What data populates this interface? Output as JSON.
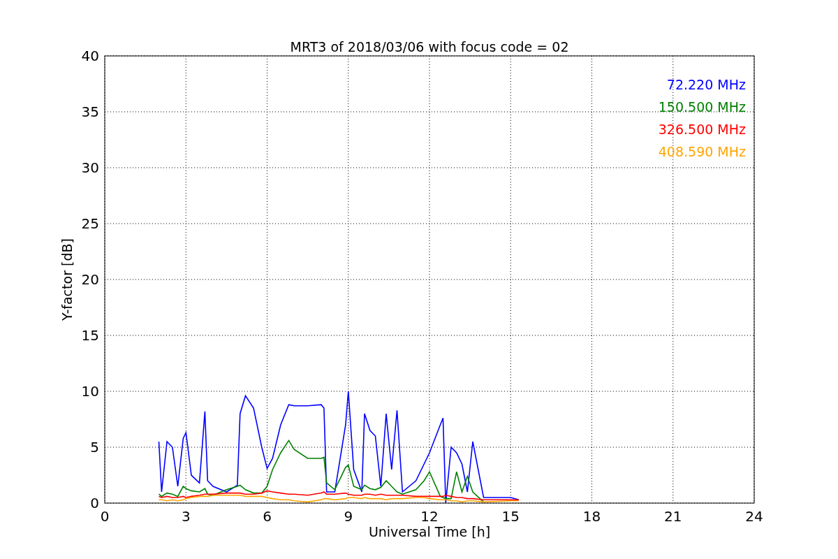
{
  "figure": {
    "chart_data": {
      "type": "line",
      "title": "MRT3 of 2018/03/06 with focus code = 02",
      "xlabel": "Universal Time [h]",
      "ylabel": "Y-factor [dB]",
      "x": [
        2.0,
        2.1,
        2.3,
        2.5,
        2.7,
        2.9,
        3.0,
        3.2,
        3.5,
        3.7,
        3.8,
        4.0,
        4.5,
        4.9,
        5.0,
        5.2,
        5.5,
        5.8,
        6.0,
        6.2,
        6.5,
        6.8,
        7.0,
        7.5,
        8.0,
        8.1,
        8.2,
        8.5,
        8.9,
        9.0,
        9.2,
        9.5,
        9.6,
        9.8,
        10.0,
        10.2,
        10.4,
        10.6,
        10.8,
        11.0,
        11.5,
        11.8,
        12.0,
        12.4,
        12.5,
        12.6,
        12.8,
        13.0,
        13.2,
        13.4,
        13.6,
        14.0,
        15.0,
        15.3
      ],
      "series": [
        {
          "name": "72.220 MHz",
          "color": "#0000ff",
          "values": [
            5.5,
            1,
            5.5,
            5,
            1.5,
            5.8,
            6.3,
            2.5,
            1.8,
            8.2,
            2,
            1.5,
            1,
            1.6,
            8,
            9.6,
            8.5,
            5,
            3.1,
            4,
            7,
            8.8,
            8.7,
            8.7,
            8.8,
            8.5,
            1,
            1,
            7,
            10,
            3,
            1,
            8,
            6.5,
            6,
            1.5,
            8,
            3,
            8.3,
            1,
            2,
            3.5,
            4.5,
            7,
            7.6,
            0,
            5,
            4.5,
            3.5,
            1,
            5.5,
            0.5,
            0.5,
            0.3
          ]
        },
        {
          "name": "150.500 MHz",
          "color": "#008000",
          "values": [
            0.8,
            0.6,
            0.9,
            0.8,
            0.6,
            1.5,
            1.3,
            1.1,
            1,
            1.3,
            0.8,
            0.7,
            1.2,
            1.5,
            1.6,
            1.2,
            0.9,
            0.9,
            1.5,
            3,
            4.5,
            5.6,
            4.8,
            4,
            4,
            4.1,
            1.8,
            1.2,
            3.2,
            3.4,
            1.5,
            1.2,
            1.6,
            1.3,
            1.2,
            1.4,
            2,
            1.5,
            1,
            0.8,
            1.2,
            2,
            2.8,
            0.6,
            0.5,
            0.4,
            0.4,
            2.8,
            1,
            2.4,
            1,
            0.1,
            null,
            null
          ]
        },
        {
          "name": "326.500 MHz",
          "color": "#ff0000",
          "values": [
            0.6,
            0.5,
            0.6,
            0.5,
            0.5,
            0.6,
            0.5,
            0.6,
            0.7,
            0.8,
            0.8,
            0.8,
            0.9,
            0.9,
            0.9,
            0.8,
            0.8,
            0.9,
            1.1,
            1,
            0.9,
            0.8,
            0.8,
            0.7,
            0.9,
            1,
            0.8,
            0.8,
            0.9,
            0.8,
            0.7,
            0.7,
            0.8,
            0.8,
            0.7,
            0.8,
            0.7,
            0.7,
            0.7,
            0.7,
            0.6,
            0.6,
            0.6,
            0.6,
            0.6,
            0.7,
            0.6,
            0.5,
            0.5,
            0.4,
            0.4,
            0.3,
            0.3,
            0.3
          ]
        },
        {
          "name": "408.590 MHz",
          "color": "#ffa500",
          "values": [
            0.3,
            0.3,
            0.2,
            0.3,
            0.2,
            0.3,
            0.4,
            0.5,
            0.6,
            0.6,
            0.6,
            0.7,
            0.7,
            0.7,
            0.7,
            0.6,
            0.6,
            0.6,
            0.5,
            0.4,
            0.3,
            0.3,
            0.2,
            0.1,
            0.3,
            0.4,
            0.4,
            0.3,
            0.4,
            0.5,
            0.5,
            0.4,
            0.5,
            0.4,
            0.4,
            0.4,
            0.3,
            0.4,
            0.4,
            0.4,
            0.5,
            0.5,
            0.4,
            0.3,
            0.3,
            0.3,
            0.2,
            0.2,
            0.1,
            0.2,
            0.2,
            0.1,
            0.2,
            0.2
          ]
        }
      ],
      "grid": true,
      "xlim": [
        0,
        24
      ],
      "ylim": [
        0,
        40
      ],
      "xticks": [
        0,
        3,
        6,
        9,
        12,
        15,
        18,
        21,
        24
      ],
      "yticks": [
        0,
        5,
        10,
        15,
        20,
        25,
        30,
        35,
        40
      ]
    }
  }
}
